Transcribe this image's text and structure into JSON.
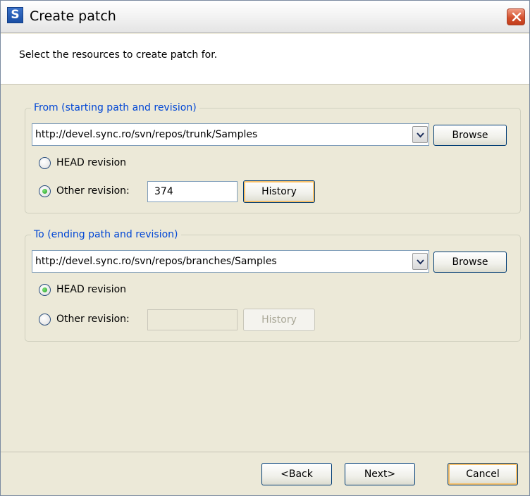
{
  "window": {
    "title": "Create patch",
    "app_icon": "S"
  },
  "banner": {
    "text": "Select the resources to create patch for."
  },
  "from_group": {
    "legend": "From (starting path and revision)",
    "url": "http://devel.sync.ro/svn/repos/trunk/Samples",
    "browse_label": "Browse",
    "head_revision_label": "HEAD revision",
    "head_selected": false,
    "other_revision_label": "Other revision:",
    "other_selected": true,
    "revision_value": "374",
    "history_label": "History"
  },
  "to_group": {
    "legend": "To (ending path and revision)",
    "url": "http://devel.sync.ro/svn/repos/branches/Samples",
    "browse_label": "Browse",
    "head_revision_label": "HEAD revision",
    "head_selected": true,
    "other_revision_label": "Other revision:",
    "other_selected": false,
    "revision_value": "",
    "history_label": "History"
  },
  "footer": {
    "back_label": "<Back",
    "next_label": "Next>",
    "cancel_label": "Cancel"
  },
  "icons": {
    "app": "svn-s-icon",
    "close": "close-icon",
    "dropdown": "chevron-down-icon"
  },
  "colors": {
    "legend": "#0046d5",
    "close_button": "#d4512e",
    "focus_ring": "#f7c06a"
  }
}
